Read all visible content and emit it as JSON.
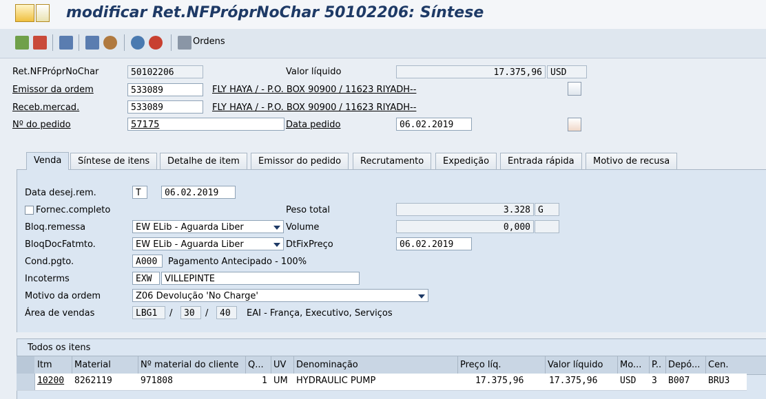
{
  "title": "modificar Ret.NFPróprNoChar 50102206: Síntese",
  "toolbar": {
    "icons": [
      "display-icon",
      "check-cancel-icon",
      "save-icon",
      "document-icon",
      "person-icon",
      "reference-icon",
      "delete-icon",
      "orders-icon"
    ],
    "orders_label": "Ordens"
  },
  "header": {
    "doc_label": "Ret.NFPróprNoChar",
    "doc_value": "50102206",
    "net_value_label": "Valor líquido",
    "net_value": "17.375,96",
    "currency": "USD",
    "sold_to_label": "Emissor da ordem",
    "sold_to_value": "533089",
    "sold_to_text": "FLY HAYA / - P.O. BOX 90900 / 11623 RIYADH--",
    "ship_to_label": "Receb.mercad.",
    "ship_to_value": "533089",
    "ship_to_text": "FLY HAYA / - P.O. BOX 90900 / 11623 RIYADH--",
    "po_label": "Nº do pedido",
    "po_value": "57175",
    "po_date_label": "Data pedido",
    "po_date_value": "06.02.2019"
  },
  "tabs": [
    {
      "label": "Venda"
    },
    {
      "label": "Síntese de itens"
    },
    {
      "label": "Detalhe de item"
    },
    {
      "label": "Emissor do pedido"
    },
    {
      "label": "Recrutamento"
    },
    {
      "label": "Expedição"
    },
    {
      "label": "Entrada rápida"
    },
    {
      "label": "Motivo de recusa"
    }
  ],
  "sales": {
    "req_deliv_label": "Data desej.rem.",
    "req_deliv_type": "T",
    "req_deliv_date": "06.02.2019",
    "complete_label": "Fornec.completo",
    "weight_label": "Peso total",
    "weight_value": "3.328",
    "weight_unit": "G",
    "deliv_block_label": "Bloq.remessa",
    "deliv_block_value": "EW ELib - Aguarda Liber",
    "volume_label": "Volume",
    "volume_value": "0,000",
    "bill_block_label": "BloqDocFatmto.",
    "bill_block_value": "EW ELib - Aguarda Liber",
    "pricing_date_label": "DtFixPreço",
    "pricing_date_value": "06.02.2019",
    "payment_label": "Cond.pgto.",
    "payment_code": "A000",
    "payment_text": "Pagamento Antecipado - 100%",
    "incoterms_label": "Incoterms",
    "incoterms_code": "EXW",
    "incoterms_place": "VILLEPINTE",
    "reason_label": "Motivo da ordem",
    "reason_value": "Z06 Devolução 'No Charge'",
    "sales_area_label": "Área de vendas",
    "sales_org": "LBG1",
    "sep1": "/",
    "dist_channel": "30",
    "sep2": "/",
    "division": "40",
    "sales_area_text": "EAI - França, Executivo, Serviços"
  },
  "items": {
    "title": "Todos os itens",
    "columns": [
      "Itm",
      "Material",
      "Nº material do cliente",
      "Q...",
      "UV",
      "Denominação",
      "Preço líq.",
      "Valor líquido",
      "Mo...",
      "P..",
      "Depó...",
      "Cen."
    ],
    "rows": [
      {
        "itm": "10200",
        "material": "8262119",
        "cust_mat": "971808",
        "qty": "1",
        "uv": "UM",
        "desc": "HYDRAULIC PUMP",
        "price": "17.375,96",
        "net": "17.375,96",
        "curr": "USD",
        "p": "3",
        "depot": "B007",
        "plant": "BRU3"
      }
    ]
  }
}
